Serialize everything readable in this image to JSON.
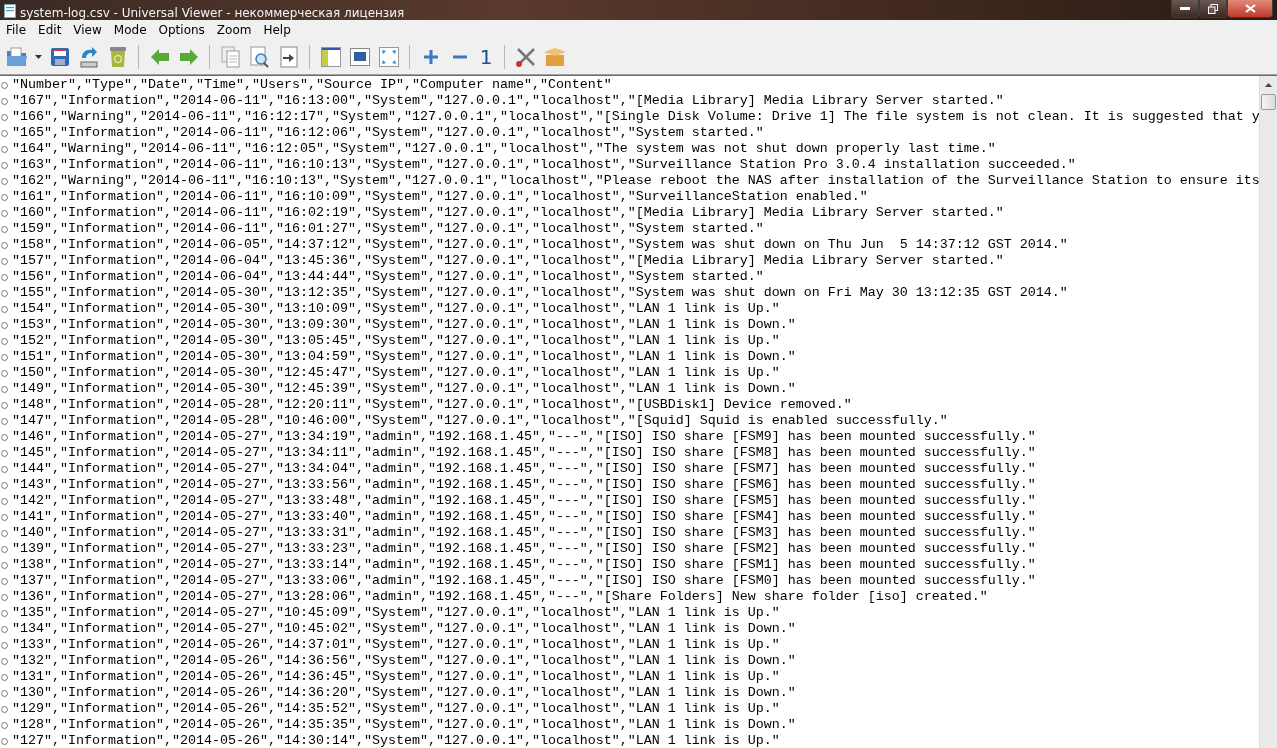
{
  "window": {
    "title": "system-log.csv - Universal Viewer - некоммерческая лицензия"
  },
  "menu": [
    "File",
    "Edit",
    "View",
    "Mode",
    "Options",
    "Zoom",
    "Help"
  ],
  "toolbar": {
    "zoom_label": "1"
  },
  "lines": [
    "\"Number\",\"Type\",\"Date\",\"Time\",\"Users\",\"Source IP\",\"Computer name\",\"Content\"",
    "\"167\",\"Information\",\"2014-06-11\",\"16:13:00\",\"System\",\"127.0.0.1\",\"localhost\",\"[Media Library] Media Library Server started.\"",
    "\"166\",\"Warning\",\"2014-06-11\",\"16:12:17\",\"System\",\"127.0.0.1\",\"localhost\",\"[Single Disk Volume: Drive 1] The file system is not clean. It is suggested that y",
    "\"165\",\"Information\",\"2014-06-11\",\"16:12:06\",\"System\",\"127.0.0.1\",\"localhost\",\"System started.\"",
    "\"164\",\"Warning\",\"2014-06-11\",\"16:12:05\",\"System\",\"127.0.0.1\",\"localhost\",\"The system was not shut down properly last time.\"",
    "\"163\",\"Information\",\"2014-06-11\",\"16:10:13\",\"System\",\"127.0.0.1\",\"localhost\",\"Surveillance Station Pro 3.0.4 installation succeeded.\"",
    "\"162\",\"Warning\",\"2014-06-11\",\"16:10:13\",\"System\",\"127.0.0.1\",\"localhost\",\"Please reboot the NAS after installation of the Surveillance Station to ensure its",
    "\"161\",\"Information\",\"2014-06-11\",\"16:10:09\",\"System\",\"127.0.0.1\",\"localhost\",\"SurveillanceStation enabled.\"",
    "\"160\",\"Information\",\"2014-06-11\",\"16:02:19\",\"System\",\"127.0.0.1\",\"localhost\",\"[Media Library] Media Library Server started.\"",
    "\"159\",\"Information\",\"2014-06-11\",\"16:01:27\",\"System\",\"127.0.0.1\",\"localhost\",\"System started.\"",
    "\"158\",\"Information\",\"2014-06-05\",\"14:37:12\",\"System\",\"127.0.0.1\",\"localhost\",\"System was shut down on Thu Jun  5 14:37:12 GST 2014.\"",
    "\"157\",\"Information\",\"2014-06-04\",\"13:45:36\",\"System\",\"127.0.0.1\",\"localhost\",\"[Media Library] Media Library Server started.\"",
    "\"156\",\"Information\",\"2014-06-04\",\"13:44:44\",\"System\",\"127.0.0.1\",\"localhost\",\"System started.\"",
    "\"155\",\"Information\",\"2014-05-30\",\"13:12:35\",\"System\",\"127.0.0.1\",\"localhost\",\"System was shut down on Fri May 30 13:12:35 GST 2014.\"",
    "\"154\",\"Information\",\"2014-05-30\",\"13:10:09\",\"System\",\"127.0.0.1\",\"localhost\",\"LAN 1 link is Up.\"",
    "\"153\",\"Information\",\"2014-05-30\",\"13:09:30\",\"System\",\"127.0.0.1\",\"localhost\",\"LAN 1 link is Down.\"",
    "\"152\",\"Information\",\"2014-05-30\",\"13:05:45\",\"System\",\"127.0.0.1\",\"localhost\",\"LAN 1 link is Up.\"",
    "\"151\",\"Information\",\"2014-05-30\",\"13:04:59\",\"System\",\"127.0.0.1\",\"localhost\",\"LAN 1 link is Down.\"",
    "\"150\",\"Information\",\"2014-05-30\",\"12:45:47\",\"System\",\"127.0.0.1\",\"localhost\",\"LAN 1 link is Up.\"",
    "\"149\",\"Information\",\"2014-05-30\",\"12:45:39\",\"System\",\"127.0.0.1\",\"localhost\",\"LAN 1 link is Down.\"",
    "\"148\",\"Information\",\"2014-05-28\",\"12:20:11\",\"System\",\"127.0.0.1\",\"localhost\",\"[USBDisk1] Device removed.\"",
    "\"147\",\"Information\",\"2014-05-28\",\"10:46:00\",\"System\",\"127.0.0.1\",\"localhost\",\"[Squid] Squid is enabled successfully.\"",
    "\"146\",\"Information\",\"2014-05-27\",\"13:34:19\",\"admin\",\"192.168.1.45\",\"---\",\"[ISO] ISO share [FSM9] has been mounted successfully.\"",
    "\"145\",\"Information\",\"2014-05-27\",\"13:34:11\",\"admin\",\"192.168.1.45\",\"---\",\"[ISO] ISO share [FSM8] has been mounted successfully.\"",
    "\"144\",\"Information\",\"2014-05-27\",\"13:34:04\",\"admin\",\"192.168.1.45\",\"---\",\"[ISO] ISO share [FSM7] has been mounted successfully.\"",
    "\"143\",\"Information\",\"2014-05-27\",\"13:33:56\",\"admin\",\"192.168.1.45\",\"---\",\"[ISO] ISO share [FSM6] has been mounted successfully.\"",
    "\"142\",\"Information\",\"2014-05-27\",\"13:33:48\",\"admin\",\"192.168.1.45\",\"---\",\"[ISO] ISO share [FSM5] has been mounted successfully.\"",
    "\"141\",\"Information\",\"2014-05-27\",\"13:33:40\",\"admin\",\"192.168.1.45\",\"---\",\"[ISO] ISO share [FSM4] has been mounted successfully.\"",
    "\"140\",\"Information\",\"2014-05-27\",\"13:33:31\",\"admin\",\"192.168.1.45\",\"---\",\"[ISO] ISO share [FSM3] has been mounted successfully.\"",
    "\"139\",\"Information\",\"2014-05-27\",\"13:33:23\",\"admin\",\"192.168.1.45\",\"---\",\"[ISO] ISO share [FSM2] has been mounted successfully.\"",
    "\"138\",\"Information\",\"2014-05-27\",\"13:33:14\",\"admin\",\"192.168.1.45\",\"---\",\"[ISO] ISO share [FSM1] has been mounted successfully.\"",
    "\"137\",\"Information\",\"2014-05-27\",\"13:33:06\",\"admin\",\"192.168.1.45\",\"---\",\"[ISO] ISO share [FSM0] has been mounted successfully.\"",
    "\"136\",\"Information\",\"2014-05-27\",\"13:28:06\",\"admin\",\"192.168.1.45\",\"---\",\"[Share Folders] New share folder [iso] created.\"",
    "\"135\",\"Information\",\"2014-05-27\",\"10:45:09\",\"System\",\"127.0.0.1\",\"localhost\",\"LAN 1 link is Up.\"",
    "\"134\",\"Information\",\"2014-05-27\",\"10:45:02\",\"System\",\"127.0.0.1\",\"localhost\",\"LAN 1 link is Down.\"",
    "\"133\",\"Information\",\"2014-05-26\",\"14:37:01\",\"System\",\"127.0.0.1\",\"localhost\",\"LAN 1 link is Up.\"",
    "\"132\",\"Information\",\"2014-05-26\",\"14:36:56\",\"System\",\"127.0.0.1\",\"localhost\",\"LAN 1 link is Down.\"",
    "\"131\",\"Information\",\"2014-05-26\",\"14:36:45\",\"System\",\"127.0.0.1\",\"localhost\",\"LAN 1 link is Up.\"",
    "\"130\",\"Information\",\"2014-05-26\",\"14:36:20\",\"System\",\"127.0.0.1\",\"localhost\",\"LAN 1 link is Down.\"",
    "\"129\",\"Information\",\"2014-05-26\",\"14:35:52\",\"System\",\"127.0.0.1\",\"localhost\",\"LAN 1 link is Up.\"",
    "\"128\",\"Information\",\"2014-05-26\",\"14:35:35\",\"System\",\"127.0.0.1\",\"localhost\",\"LAN 1 link is Down.\"",
    "\"127\",\"Information\",\"2014-05-26\",\"14:30:14\",\"System\",\"127.0.0.1\",\"localhost\",\"LAN 1 link is Up.\""
  ]
}
